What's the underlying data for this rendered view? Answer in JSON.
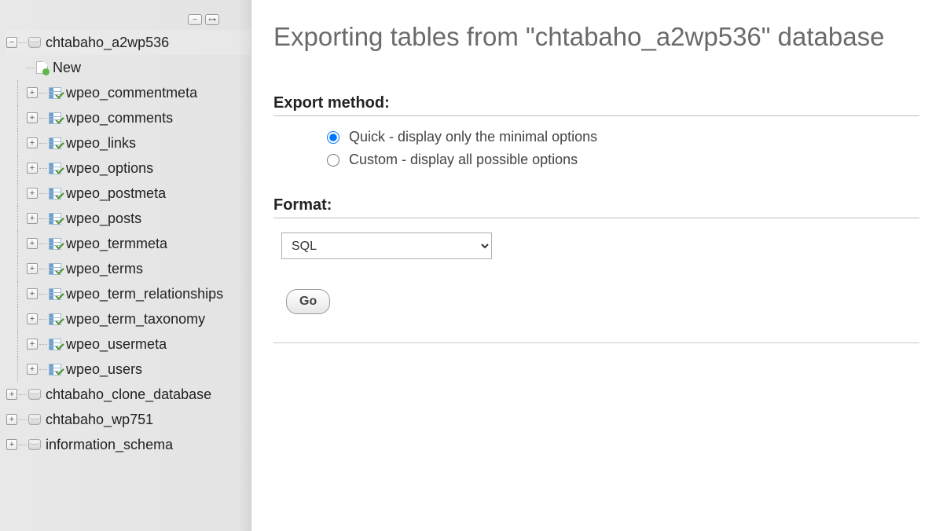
{
  "sidebar": {
    "active_db": "chtabaho_a2wp536",
    "new_label": "New",
    "tables": [
      "wpeo_commentmeta",
      "wpeo_comments",
      "wpeo_links",
      "wpeo_options",
      "wpeo_postmeta",
      "wpeo_posts",
      "wpeo_termmeta",
      "wpeo_terms",
      "wpeo_term_relationships",
      "wpeo_term_taxonomy",
      "wpeo_usermeta",
      "wpeo_users"
    ],
    "other_dbs": [
      "chtabaho_clone_database",
      "chtabaho_wp751",
      "information_schema"
    ]
  },
  "main": {
    "title": "Exporting tables from \"chtabaho_a2wp536\" database",
    "export_method_heading": "Export method:",
    "method_quick": "Quick - display only the minimal options",
    "method_custom": "Custom - display all possible options",
    "format_heading": "Format:",
    "format_selected": "SQL",
    "go_label": "Go"
  }
}
